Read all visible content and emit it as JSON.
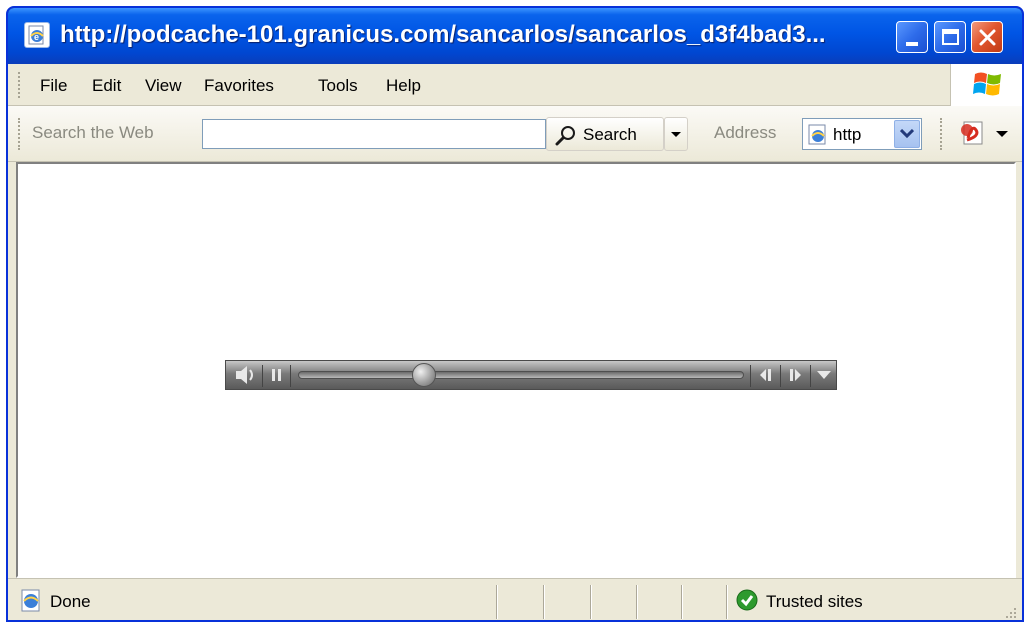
{
  "window": {
    "title": "http://podcache-101.granicus.com/sancarlos/sancarlos_d3f4bad3..."
  },
  "menu": {
    "items": [
      "File",
      "Edit",
      "View",
      "Favorites",
      "Tools",
      "Help"
    ]
  },
  "search_toolbar": {
    "label": "Search the Web",
    "input_value": "",
    "search_button": "Search",
    "address_label": "Address",
    "address_value": "http"
  },
  "player": {
    "progress": 0.27
  },
  "status": {
    "text": "Done",
    "zone": "Trusted sites"
  },
  "colors": {
    "title_bar": "#0055e5",
    "chrome": "#ece9d8",
    "close_button": "#e2572f"
  },
  "icons": {
    "page": "ie-page-icon",
    "minimize": "minimize-icon",
    "maximize": "maximize-icon",
    "close": "close-icon",
    "windows_logo": "windows-flag-icon",
    "search": "magnifier-icon",
    "pdf": "pdf-icon",
    "volume": "speaker-icon",
    "pause": "pause-icon",
    "rewind": "rewind-icon",
    "forward": "forward-icon",
    "menu_arrow": "dropdown-triangle-icon",
    "trusted": "check-circle-icon"
  }
}
